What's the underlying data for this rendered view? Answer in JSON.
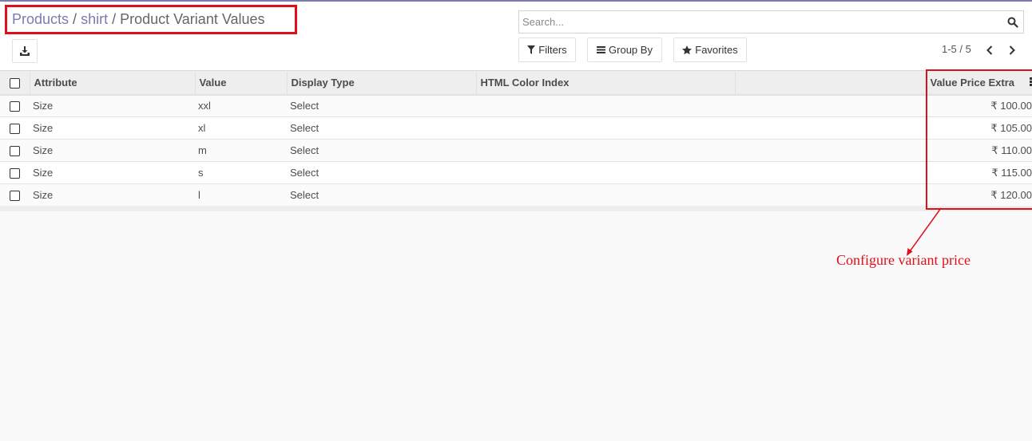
{
  "breadcrumb": {
    "items": [
      {
        "label": "Products",
        "link": true
      },
      {
        "label": "shirt",
        "link": true
      },
      {
        "label": "Product Variant Values",
        "link": false
      }
    ],
    "separator": "/"
  },
  "search": {
    "placeholder": "Search...",
    "value": ""
  },
  "toolbar": {
    "filters_label": "Filters",
    "groupby_label": "Group By",
    "favorites_label": "Favorites"
  },
  "pager": {
    "value": "1-5 / 5"
  },
  "table": {
    "columns": [
      "Attribute",
      "Value",
      "Display Type",
      "HTML Color Index",
      "",
      "Value Price Extra"
    ],
    "rows": [
      {
        "attribute": "Size",
        "value": "xxl",
        "display_type": "Select",
        "color_index": "",
        "price_extra": "₹ 100.00"
      },
      {
        "attribute": "Size",
        "value": "xl",
        "display_type": "Select",
        "color_index": "",
        "price_extra": "₹ 105.00"
      },
      {
        "attribute": "Size",
        "value": "m",
        "display_type": "Select",
        "color_index": "",
        "price_extra": "₹ 110.00"
      },
      {
        "attribute": "Size",
        "value": "s",
        "display_type": "Select",
        "color_index": "",
        "price_extra": "₹ 115.00"
      },
      {
        "attribute": "Size",
        "value": "l",
        "display_type": "Select",
        "color_index": "",
        "price_extra": "₹ 120.00"
      }
    ]
  },
  "annotation": {
    "text": "Configure variant price"
  },
  "colors": {
    "brand": "#7c7bad",
    "annotation": "#e0101b"
  },
  "icons": [
    "download-icon",
    "search-icon",
    "filter-icon",
    "bars-icon",
    "star-icon",
    "chevron-left-icon",
    "chevron-right-icon",
    "optional-columns-icon"
  ]
}
